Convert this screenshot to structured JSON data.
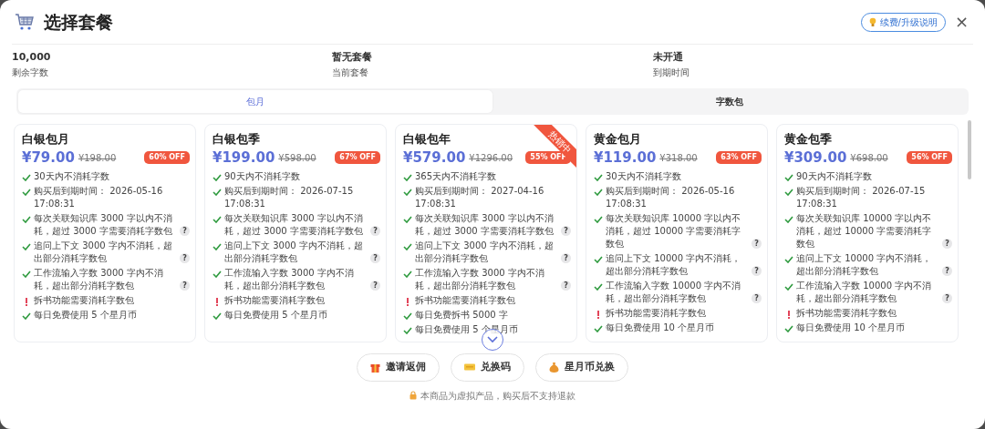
{
  "dialog": {
    "title": "选择套餐",
    "help_button": "续费/升级说明",
    "close": "×"
  },
  "stats": [
    {
      "value": "10,000",
      "label": "剩余字数"
    },
    {
      "value": "暂无套餐",
      "label": "当前套餐"
    },
    {
      "value": "未开通",
      "label": "到期时间"
    }
  ],
  "tabs": [
    {
      "label": "包月",
      "selected": true
    },
    {
      "label": "字数包",
      "selected": false
    }
  ],
  "plans": [
    {
      "name": "白银包月",
      "price": "¥79.00",
      "original_price": "¥198.00",
      "discount": "60% OFF",
      "features": [
        {
          "kind": "check",
          "text": "30天内不消耗字数"
        },
        {
          "kind": "check",
          "text": "购买后到期时间：  2026-05-16 17:08:31"
        },
        {
          "kind": "check",
          "text": "每次关联知识库 3000 字以内不消耗，超过 3000 字需要消耗字数包",
          "hint": "?"
        },
        {
          "kind": "check",
          "text": "追问上下文 3000 字内不消耗，超出部分消耗字数包",
          "hint": "?"
        },
        {
          "kind": "check",
          "text": "工作流输入字数 3000 字内不消耗，超出部分消耗字数包",
          "hint": "?"
        },
        {
          "kind": "warn",
          "text": "拆书功能需要消耗字数包"
        },
        {
          "kind": "check",
          "text": "每日免费使用 5 个星月币"
        }
      ]
    },
    {
      "name": "白银包季",
      "price": "¥199.00",
      "original_price": "¥598.00",
      "discount": "67% OFF",
      "features": [
        {
          "kind": "check",
          "text": "90天内不消耗字数"
        },
        {
          "kind": "check",
          "text": "购买后到期时间：  2026-07-15 17:08:31"
        },
        {
          "kind": "check",
          "text": "每次关联知识库 3000 字以内不消耗，超过 3000 字需要消耗字数包",
          "hint": "?"
        },
        {
          "kind": "check",
          "text": "追问上下文 3000 字内不消耗，超出部分消耗字数包",
          "hint": "?"
        },
        {
          "kind": "check",
          "text": "工作流输入字数 3000 字内不消耗，超出部分消耗字数包",
          "hint": "?"
        },
        {
          "kind": "warn",
          "text": "拆书功能需要消耗字数包"
        },
        {
          "kind": "check",
          "text": "每日免费使用 5 个星月币"
        }
      ]
    },
    {
      "name": "白银包年",
      "price": "¥579.00",
      "original_price": "¥1296.00",
      "discount": "55% OFF",
      "ribbon": "热销中",
      "features": [
        {
          "kind": "check",
          "text": "365天内不消耗字数"
        },
        {
          "kind": "check",
          "text": "购买后到期时间：  2027-04-16 17:08:31"
        },
        {
          "kind": "check",
          "text": "每次关联知识库 3000 字以内不消耗，超过 3000 字需要消耗字数包",
          "hint": "?"
        },
        {
          "kind": "check",
          "text": "追问上下文 3000 字内不消耗，超出部分消耗字数包",
          "hint": "?"
        },
        {
          "kind": "check",
          "text": "工作流输入字数 3000 字内不消耗，超出部分消耗字数包",
          "hint": "?"
        },
        {
          "kind": "warn",
          "text": "拆书功能需要消耗字数包"
        },
        {
          "kind": "check",
          "text": "每日免费拆书 5000 字"
        },
        {
          "kind": "check",
          "text": "每日免费使用 5 个星月币"
        }
      ]
    },
    {
      "name": "黄金包月",
      "price": "¥119.00",
      "original_price": "¥318.00",
      "discount": "63% OFF",
      "features": [
        {
          "kind": "check",
          "text": "30天内不消耗字数"
        },
        {
          "kind": "check",
          "text": "购买后到期时间：  2026-05-16 17:08:31"
        },
        {
          "kind": "check",
          "text": "每次关联知识库 10000 字以内不消耗，超过 10000 字需要消耗字数包",
          "hint": "?"
        },
        {
          "kind": "check",
          "text": "追问上下文 10000 字内不消耗，超出部分消耗字数包",
          "hint": "?"
        },
        {
          "kind": "check",
          "text": "工作流输入字数 10000 字内不消耗，超出部分消耗字数包",
          "hint": "?"
        },
        {
          "kind": "warn",
          "text": "拆书功能需要消耗字数包"
        },
        {
          "kind": "check",
          "text": "每日免费使用 10 个星月币"
        }
      ]
    },
    {
      "name": "黄金包季",
      "price": "¥309.00",
      "original_price": "¥698.00",
      "discount": "56% OFF",
      "features": [
        {
          "kind": "check",
          "text": "90天内不消耗字数"
        },
        {
          "kind": "check",
          "text": "购买后到期时间：  2026-07-15 17:08:31"
        },
        {
          "kind": "check",
          "text": "每次关联知识库 10000 字以内不消耗，超过 10000 字需要消耗字数包",
          "hint": "?"
        },
        {
          "kind": "check",
          "text": "追问上下文 10000 字内不消耗，超出部分消耗字数包",
          "hint": "?"
        },
        {
          "kind": "check",
          "text": "工作流输入字数 10000 字内不消耗，超出部分消耗字数包",
          "hint": "?"
        },
        {
          "kind": "warn",
          "text": "拆书功能需要消耗字数包"
        },
        {
          "kind": "check",
          "text": "每日免费使用 10 个星月币"
        }
      ]
    }
  ],
  "actions": [
    {
      "label": "邀请返佣"
    },
    {
      "label": "兑换码"
    },
    {
      "label": "星月币兑换"
    }
  ],
  "notice": "本商品为虚拟产品，购买后不支持退款"
}
